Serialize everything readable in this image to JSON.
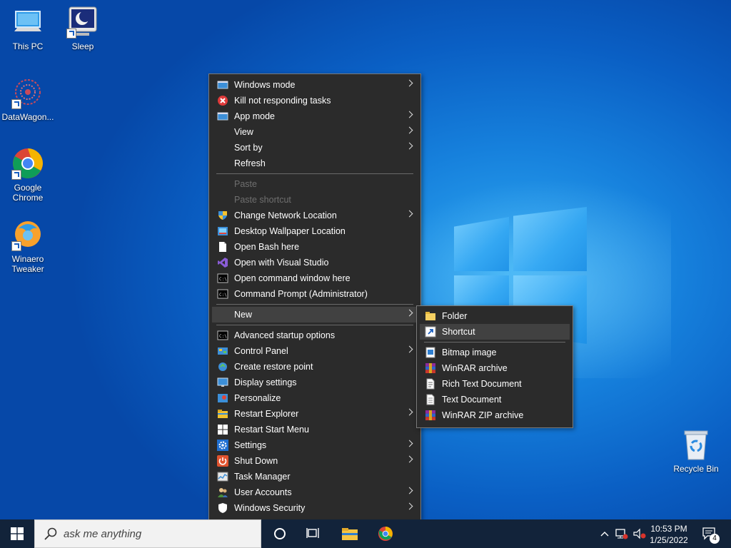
{
  "desktop_icons": [
    {
      "label": "This PC",
      "icon": "this-pc-icon"
    },
    {
      "label": "Sleep",
      "icon": "sleep-icon"
    },
    {
      "label": "DataWagon...",
      "icon": "datawagon-icon"
    },
    {
      "label": "Google\nChrome",
      "icon": "chrome-icon"
    },
    {
      "label": "Winaero\nTweaker",
      "icon": "winaero-icon"
    },
    {
      "label": "Recycle Bin",
      "icon": "recycle-bin-icon"
    }
  ],
  "context_menu": {
    "items": [
      {
        "label": "Windows mode",
        "icon": "windows-mode-icon",
        "submenu": true
      },
      {
        "label": "Kill not responding tasks",
        "icon": "kill-icon",
        "submenu": false
      },
      {
        "label": "App mode",
        "icon": "app-mode-icon",
        "submenu": true
      },
      {
        "label": "View",
        "icon": "",
        "submenu": true
      },
      {
        "label": "Sort by",
        "icon": "",
        "submenu": true
      },
      {
        "label": "Refresh",
        "icon": "",
        "submenu": false
      },
      {
        "label": "Paste",
        "icon": "",
        "submenu": false,
        "disabled": true
      },
      {
        "label": "Paste shortcut",
        "icon": "",
        "submenu": false,
        "disabled": true
      },
      {
        "label": "Change Network Location",
        "icon": "shield-icon",
        "submenu": true
      },
      {
        "label": "Desktop Wallpaper Location",
        "icon": "wallpaper-icon",
        "submenu": false
      },
      {
        "label": "Open Bash here",
        "icon": "document-icon",
        "submenu": false
      },
      {
        "label": "Open with Visual Studio",
        "icon": "visual-studio-icon",
        "submenu": false
      },
      {
        "label": "Open command window here",
        "icon": "cmd-icon",
        "submenu": false
      },
      {
        "label": "Command Prompt (Administrator)",
        "icon": "cmd-icon",
        "submenu": false
      },
      {
        "label": "New",
        "icon": "",
        "submenu": true,
        "highlighted": true
      },
      {
        "label": "Advanced startup options",
        "icon": "cmd-icon",
        "submenu": false
      },
      {
        "label": "Control Panel",
        "icon": "control-panel-icon",
        "submenu": true
      },
      {
        "label": "Create restore point",
        "icon": "restore-icon",
        "submenu": false
      },
      {
        "label": "Display settings",
        "icon": "display-icon",
        "submenu": false
      },
      {
        "label": "Personalize",
        "icon": "personalize-icon",
        "submenu": false
      },
      {
        "label": "Restart Explorer",
        "icon": "explorer-icon",
        "submenu": true
      },
      {
        "label": "Restart Start Menu",
        "icon": "windows-logo-icon",
        "submenu": false
      },
      {
        "label": "Settings",
        "icon": "gear-icon",
        "submenu": true
      },
      {
        "label": "Shut Down",
        "icon": "power-icon",
        "submenu": true
      },
      {
        "label": "Task Manager",
        "icon": "task-manager-icon",
        "submenu": false
      },
      {
        "label": "User Accounts",
        "icon": "users-icon",
        "submenu": true
      },
      {
        "label": "Windows Security",
        "icon": "windows-security-icon",
        "submenu": true
      }
    ]
  },
  "new_submenu": {
    "items": [
      {
        "label": "Folder",
        "icon": "folder-icon"
      },
      {
        "label": "Shortcut",
        "icon": "shortcut-icon",
        "highlighted": true
      },
      {
        "label": "Bitmap image",
        "icon": "bitmap-icon"
      },
      {
        "label": "WinRAR archive",
        "icon": "winrar-icon"
      },
      {
        "label": "Rich Text Document",
        "icon": "rtf-icon"
      },
      {
        "label": "Text Document",
        "icon": "text-doc-icon"
      },
      {
        "label": "WinRAR ZIP archive",
        "icon": "winrar-zip-icon"
      }
    ]
  },
  "taskbar": {
    "search_placeholder": "ask me anything",
    "time": "10:53 PM",
    "date": "1/25/2022",
    "notification_count": "4"
  },
  "colors": {
    "menu_bg": "#2b2b2b",
    "menu_highlight": "#414141",
    "taskbar_bg": "#12233a",
    "wallpaper": "#0a5fc4"
  }
}
